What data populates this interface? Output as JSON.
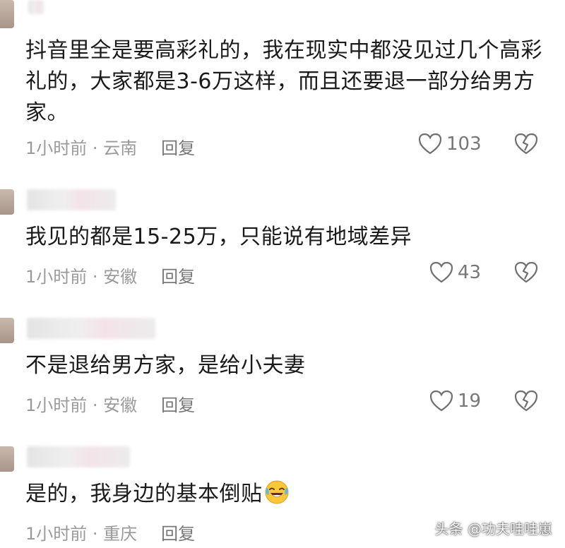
{
  "comments": [
    {
      "text": "抖音里全是要高彩礼的，我在现实中都没见过几个高彩礼的，大家都是3-6万这样，而且还要退一部分给男方家。",
      "time": "1小时前 · 云南",
      "reply_label": "回复",
      "likes": "103"
    },
    {
      "text": "我见的都是15-25万，只能说有地域差异",
      "time": "1小时前 · 安徽",
      "reply_label": "回复",
      "likes": "43"
    },
    {
      "text": "不是退给男方家，是给小夫妻",
      "time": "1小时前 · 安徽",
      "reply_label": "回复",
      "likes": "19"
    },
    {
      "text": "是的，我身边的基本倒贴",
      "time": "1小时前 · 重庆",
      "reply_label": "回复"
    }
  ],
  "watermark": "头条 @功夫哇哇崽",
  "colors": {
    "text": "#1a1a1a",
    "meta": "#9a9a9a",
    "icon": "#777777"
  },
  "icons": {
    "like": "heart-outline-icon",
    "dislike": "broken-heart-icon",
    "emoji": "laughing-crying-emoji"
  }
}
